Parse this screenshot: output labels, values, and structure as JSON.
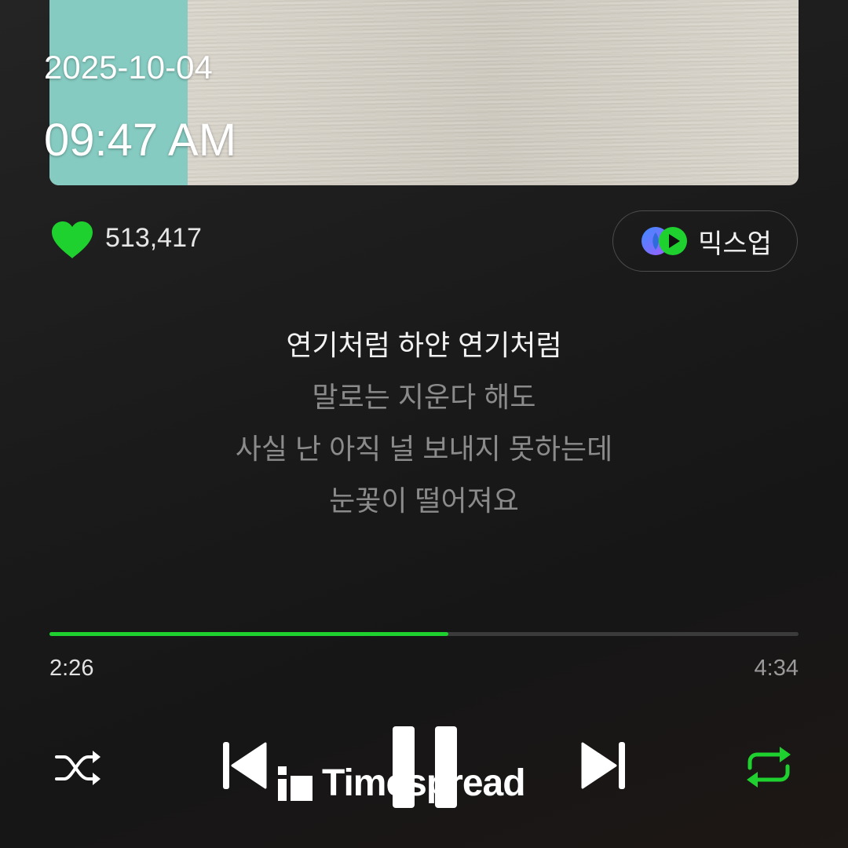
{
  "album_art": {
    "colors": {
      "teal_stripe": "#85cbc1",
      "texture": "#d6d2c8"
    }
  },
  "overlay": {
    "date": "2025-10-04",
    "time": "09:47 AM"
  },
  "like": {
    "icon": "heart-icon",
    "count": "513,417",
    "color": "#1fd12e"
  },
  "mixup": {
    "icon": "mixup-icon",
    "label": "믹스업"
  },
  "lyrics": {
    "lines": [
      "연기처럼 하얀 연기처럼",
      "말로는 지운다 해도",
      "사실 난 아직 널 보내지 못하는데",
      "눈꽃이 떨어져요"
    ],
    "current_index": 0
  },
  "progress": {
    "elapsed": "2:26",
    "total": "4:34",
    "fraction": 0.533,
    "color": "#1fd12e"
  },
  "controls": {
    "shuffle_icon": "shuffle-icon",
    "prev_icon": "skip-previous-icon",
    "pause_icon": "pause-icon",
    "next_icon": "skip-next-icon",
    "repeat_icon": "repeat-icon",
    "repeat_active_color": "#1fd12e"
  },
  "watermark": {
    "text": "Timespread",
    "icon": "timespread-logo-icon"
  }
}
